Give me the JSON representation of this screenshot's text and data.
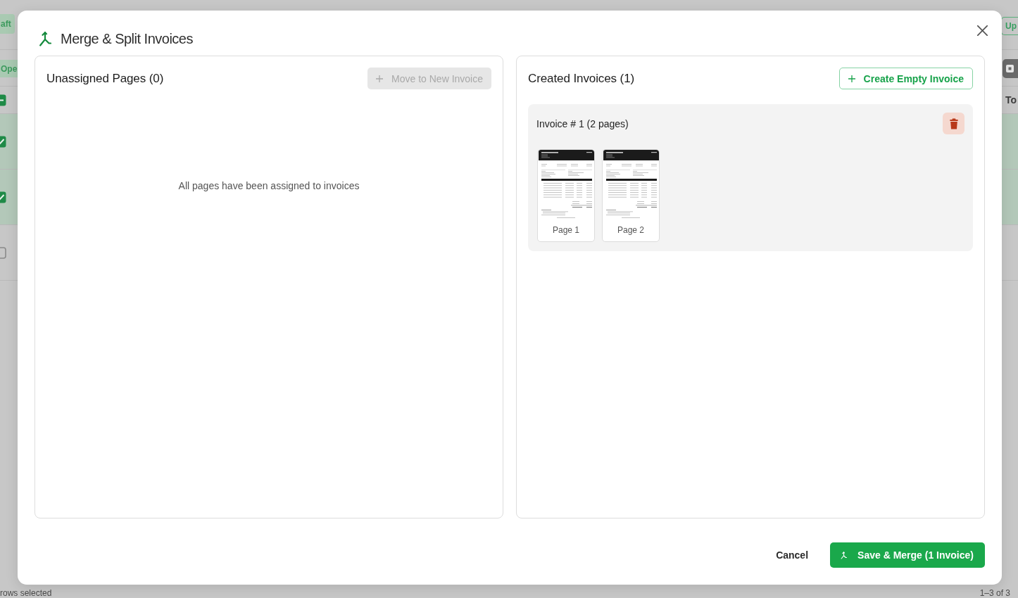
{
  "background": {
    "toolbar": {
      "chip": "aft",
      "button": "Up"
    },
    "filter_bar": {
      "chip": "Ope"
    },
    "table": {
      "header_checkbox": {
        "indeterminate": true
      },
      "column_header": "To",
      "rows": [
        {
          "selected": true
        },
        {
          "selected": true
        },
        {
          "selected": false
        }
      ]
    },
    "footer": {
      "selection_text": "rows selected",
      "pagination": "1–3 of 3"
    }
  },
  "dialog": {
    "title": "Merge & Split Invoices",
    "unassigned_panel": {
      "title": "Unassigned Pages (0)",
      "move_button": {
        "label": "Move to New Invoice",
        "disabled": true
      },
      "empty_message": "All pages have been assigned to invoices"
    },
    "invoices_panel": {
      "title": "Created Invoices (1)",
      "create_button": {
        "label": "Create Empty Invoice"
      },
      "invoices": [
        {
          "title": "Invoice # 1 (2 pages)",
          "pages": [
            {
              "label": "Page 1"
            },
            {
              "label": "Page 2"
            }
          ]
        }
      ]
    },
    "footer": {
      "cancel": "Cancel",
      "save": "Save & Merge (1 Invoice)"
    }
  }
}
